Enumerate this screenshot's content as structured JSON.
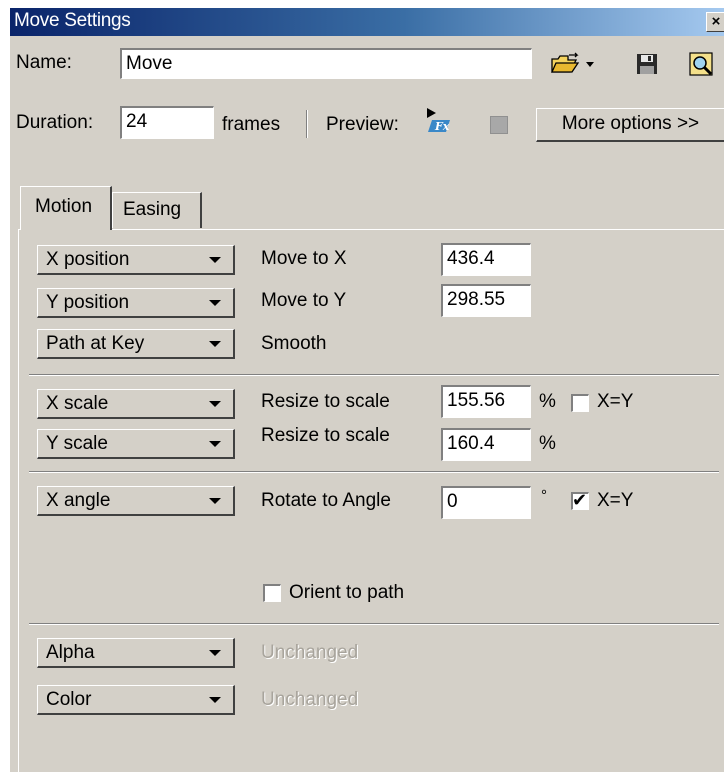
{
  "window": {
    "title": "Move Settings"
  },
  "header": {
    "name_label": "Name:",
    "name_value": "Move",
    "duration_label": "Duration:",
    "duration_value": "24",
    "frames_label": "frames",
    "preview_label": "Preview:",
    "more_options_label": "More options >>"
  },
  "icons": {
    "open": "folder-open-icon",
    "save": "floppy-save-icon",
    "browse": "magnifier-icon",
    "preview": "fx-preview-icon",
    "stop": "stop-icon",
    "close": "close-icon"
  },
  "tabs": [
    {
      "label": "Motion",
      "active": true
    },
    {
      "label": "Easing",
      "active": false
    }
  ],
  "motion": {
    "x_position": {
      "dropdown": "X position",
      "label": "Move to X",
      "value": "436.4"
    },
    "y_position": {
      "dropdown": "Y position",
      "label": "Move to Y",
      "value": "298.55"
    },
    "path": {
      "dropdown": "Path at Key",
      "label": "Smooth"
    },
    "x_scale": {
      "dropdown": "X scale",
      "label": "Resize to scale",
      "value": "155.56",
      "unit": "%",
      "xy_label": "X=Y",
      "xy_checked": false
    },
    "y_scale": {
      "dropdown": "Y scale",
      "label": "Resize to scale",
      "value": "160.4",
      "unit": "%"
    },
    "angle": {
      "dropdown": "X angle",
      "label": "Rotate to Angle",
      "value": "0",
      "unit": "°",
      "xy_label": "X=Y",
      "xy_checked": true
    },
    "orient": {
      "label": "Orient to path",
      "checked": false
    },
    "alpha": {
      "dropdown": "Alpha",
      "label": "Unchanged"
    },
    "color": {
      "dropdown": "Color",
      "label": "Unchanged"
    }
  }
}
